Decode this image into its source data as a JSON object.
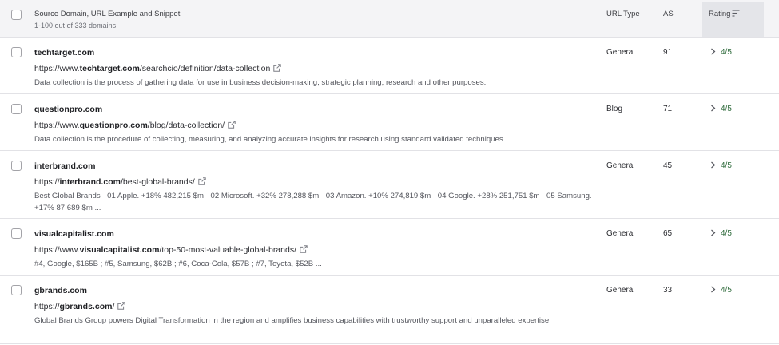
{
  "header": {
    "title": "Source Domain, URL Example and Snippet",
    "subtitle": "1-100 out of 333 domains",
    "col_url_type": "URL Type",
    "col_as": "AS",
    "col_rating": "Rating",
    "sort_icon": "sort-descending-icon"
  },
  "colors": {
    "rating_text": "#2f6b3c",
    "header_bg": "#f4f4f6",
    "active_column_bg": "#e4e5e9"
  },
  "rows": [
    {
      "domain": "techtarget.com",
      "url_prefix": "https://www.",
      "url_domain": "techtarget.com",
      "url_path": "/searchcio/definition/data-collection",
      "snippet": "Data collection is the process of gathering data for use in business decision-making, strategic planning, research and other purposes.",
      "url_type": "General",
      "as": "91",
      "rating": "4/5"
    },
    {
      "domain": "questionpro.com",
      "url_prefix": "https://www.",
      "url_domain": "questionpro.com",
      "url_path": "/blog/data-collection/",
      "snippet": "Data collection is the procedure of collecting, measuring, and analyzing accurate insights for research using standard validated techniques.",
      "url_type": "Blog",
      "as": "71",
      "rating": "4/5"
    },
    {
      "domain": "interbrand.com",
      "url_prefix": "https://",
      "url_domain": "interbrand.com",
      "url_path": "/best-global-brands/",
      "snippet": "Best Global Brands · 01 Apple. +18% 482,215 $m · 02 Microsoft. +32% 278,288 $m · 03 Amazon. +10% 274,819 $m · 04 Google. +28% 251,751 $m · 05 Samsung. +17% 87,689 $m ...",
      "url_type": "General",
      "as": "45",
      "rating": "4/5"
    },
    {
      "domain": "visualcapitalist.com",
      "url_prefix": "https://www.",
      "url_domain": "visualcapitalist.com",
      "url_path": "/top-50-most-valuable-global-brands/",
      "snippet": "#4, Google, $165B ; #5, Samsung, $62B ; #6, Coca-Cola, $57B ; #7, Toyota, $52B ...",
      "url_type": "General",
      "as": "65",
      "rating": "4/5"
    },
    {
      "domain": "gbrands.com",
      "url_prefix": "https://",
      "url_domain": "gbrands.com",
      "url_path": "/",
      "snippet": "Global Brands Group powers Digital Transformation in the region and amplifies business capabilities with trustworthy support and unparalleled expertise.",
      "url_type": "General",
      "as": "33",
      "rating": "4/5"
    }
  ]
}
